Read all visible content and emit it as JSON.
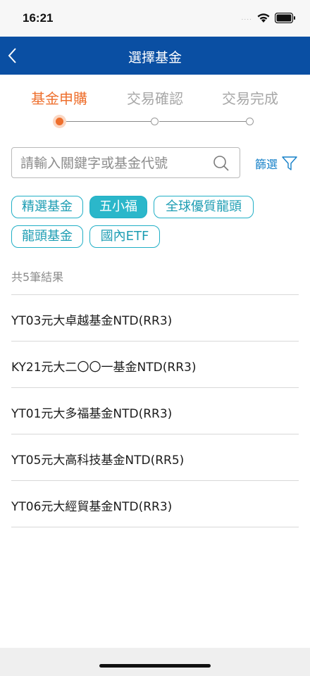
{
  "status_bar": {
    "time": "16:21",
    "signal": "....",
    "wifi_icon": "wifi-icon",
    "battery_icon": "battery-icon"
  },
  "nav": {
    "title": "選擇基金",
    "back_icon": "chevron-left-icon"
  },
  "steps": [
    {
      "label": "基金申購",
      "active": true
    },
    {
      "label": "交易確認",
      "active": false
    },
    {
      "label": "交易完成",
      "active": false
    }
  ],
  "search": {
    "placeholder": "請輸入關鍵字或基金代號",
    "value": ""
  },
  "filter": {
    "label": "篩選",
    "icon": "funnel-icon"
  },
  "chips": [
    {
      "label": "精選基金",
      "selected": false
    },
    {
      "label": "五小福",
      "selected": true
    },
    {
      "label": "全球優質龍頭",
      "selected": false
    },
    {
      "label": "龍頭基金",
      "selected": false
    },
    {
      "label": "國內ETF",
      "selected": false
    }
  ],
  "results": {
    "count_text": "共5筆結果",
    "items": [
      "YT03元大卓越基金NTD(RR3)",
      "KY21元大二〇〇一基金NTD(RR3)",
      "YT01元大多福基金NTD(RR3)",
      "YT05元大高科技基金NTD(RR5)",
      "YT06元大經貿基金NTD(RR3)"
    ]
  },
  "colors": {
    "nav": "#0a4fa3",
    "accent_orange": "#ee6f2d",
    "chip_teal": "#2bb7ca",
    "link_blue": "#1580c8"
  }
}
